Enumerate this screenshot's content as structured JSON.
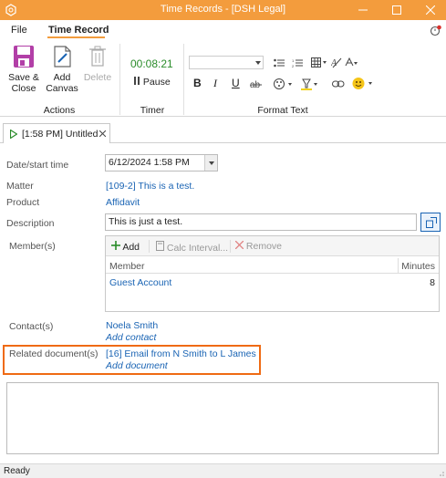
{
  "window": {
    "title": "Time Records - [DSH Legal]",
    "accent_color": "#f39c3d",
    "highlight_color": "#ef6a13"
  },
  "menu": {
    "items": [
      "File",
      "Time Record"
    ]
  },
  "ribbon": {
    "save_close": [
      "Save &",
      "Close"
    ],
    "add_canvas": [
      "Add",
      "Canvas"
    ],
    "delete": "Delete",
    "actions_group": "Actions",
    "timer_value": "00:08:21",
    "pause": "Pause",
    "timer_group": "Timer",
    "format_text_group": "Format Text"
  },
  "tab": {
    "label": "[1:58 PM] Untitled"
  },
  "form": {
    "date_label": "Date/start time",
    "date_value": "6/12/2024 1:58 PM",
    "matter_label": "Matter",
    "matter_value": "[109-2]  This is a test.",
    "product_label": "Product",
    "product_value": "Affidavit",
    "description_label": "Description",
    "description_value": "This is just a test.",
    "members_label": "Member(s)",
    "contacts_label": "Contact(s)",
    "contact_name": "Noela Smith",
    "add_contact": "Add contact",
    "related_label": "Related document(s)",
    "related_doc": "[16]  Email from N Smith to L James",
    "add_document": "Add document"
  },
  "members_grid": {
    "add": "Add",
    "calc": "Calc Interval...",
    "remove": "Remove",
    "col_member": "Member",
    "col_minutes": "Minutes",
    "rows": [
      {
        "member": "Guest Account",
        "minutes": "8"
      }
    ]
  },
  "status": {
    "text": "Ready"
  }
}
